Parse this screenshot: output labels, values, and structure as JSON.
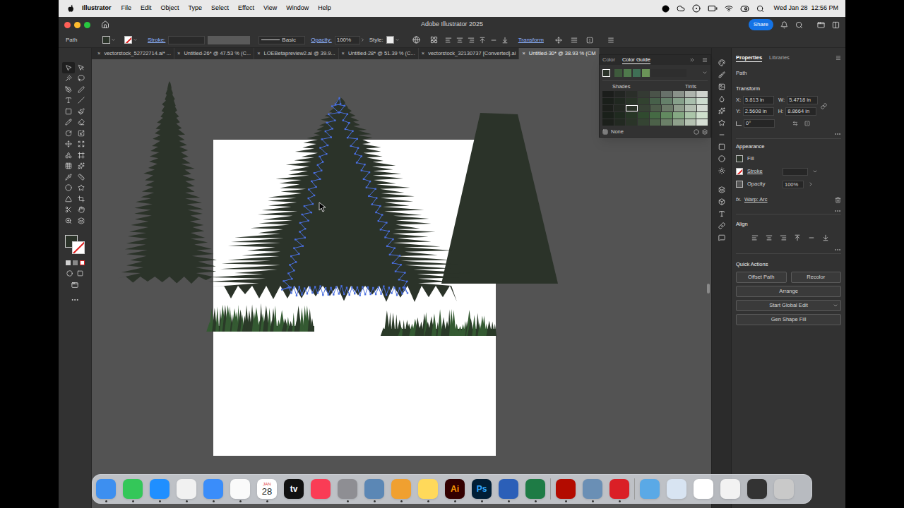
{
  "menu_bar": {
    "app": "Illustrator",
    "items": [
      "File",
      "Edit",
      "Object",
      "Type",
      "Select",
      "Effect",
      "View",
      "Window",
      "Help"
    ],
    "clock": "Wed Jan 28  12:56 PM"
  },
  "window": {
    "title": "Adobe Illustrator 2025",
    "share": "Share"
  },
  "control_bar": {
    "selection": "Path",
    "fill_color": "#2b3329",
    "stroke_label": "Stroke:",
    "profile": "Basic",
    "opacity_label": "Opacity:",
    "opacity": "100%",
    "style_label": "Style:",
    "transform": "Transform"
  },
  "tab_close": "×",
  "tabs": [
    {
      "label": "vectorstock_52722714.ai* ...",
      "selected": false
    },
    {
      "label": "Untitled-26* @ 47.53 % (C...",
      "selected": false
    },
    {
      "label": "LOEBetapreview2.ai @ 39.9...",
      "selected": false
    },
    {
      "label": "Untitled-28* @ 51.39 % (C...",
      "selected": false
    },
    {
      "label": "vectorstock_32130737 [Converted].ai",
      "selected": false
    },
    {
      "label": "Untitled-30* @ 38.93 % (CM",
      "selected": true
    }
  ],
  "color_guide": {
    "tabs": [
      {
        "label": "Color",
        "selected": false
      },
      {
        "label": "Color Guide",
        "selected": true
      }
    ],
    "harmony": [
      {
        "color": "#2b3329",
        "selected": true
      },
      {
        "color": "#3e5a3c",
        "selected": false
      },
      {
        "color": "#4f7a4c",
        "selected": false
      },
      {
        "color": "#3f6f55",
        "selected": false
      },
      {
        "color": "#6b9458",
        "selected": false
      }
    ],
    "shades": "Shades",
    "tints": "Tints",
    "none": "None",
    "grid": [
      [
        {
          "color": "#1b1d1b",
          "selected": false
        },
        {
          "color": "#222522",
          "selected": false
        },
        {
          "color": "#2a2e29",
          "selected": false
        },
        {
          "color": "#343a33",
          "selected": false
        },
        {
          "color": "#4a5349",
          "selected": false
        },
        {
          "color": "#68716a",
          "selected": false
        },
        {
          "color": "#8a928a",
          "selected": false
        },
        {
          "color": "#aeb4ad",
          "selected": false
        },
        {
          "color": "#cfd3ce",
          "selected": false
        }
      ],
      [
        {
          "color": "#1a1f1a",
          "selected": false
        },
        {
          "color": "#202820",
          "selected": false
        },
        {
          "color": "#283327",
          "selected": false
        },
        {
          "color": "#324230",
          "selected": false
        },
        {
          "color": "#47604a",
          "selected": false
        },
        {
          "color": "#65806a",
          "selected": false
        },
        {
          "color": "#86a08a",
          "selected": false
        },
        {
          "color": "#a9bfad",
          "selected": false
        },
        {
          "color": "#cddccf",
          "selected": false
        }
      ],
      [
        {
          "color": "#1c1f1b",
          "selected": false
        },
        {
          "color": "#232822",
          "selected": false
        },
        {
          "color": "#2b3329",
          "selected": true
        },
        {
          "color": "#374235",
          "selected": false
        },
        {
          "color": "#4d5c4a",
          "selected": false
        },
        {
          "color": "#6c7b69",
          "selected": false
        },
        {
          "color": "#8f9d8c",
          "selected": false
        },
        {
          "color": "#b3beb1",
          "selected": false
        },
        {
          "color": "#d4dbd3",
          "selected": false
        }
      ],
      [
        {
          "color": "#1a201a",
          "selected": false
        },
        {
          "color": "#1f2a1f",
          "selected": false
        },
        {
          "color": "#273726",
          "selected": false
        },
        {
          "color": "#304a2f",
          "selected": false
        },
        {
          "color": "#456a44",
          "selected": false
        },
        {
          "color": "#628a60",
          "selected": false
        },
        {
          "color": "#85a883",
          "selected": false
        },
        {
          "color": "#abc5a9",
          "selected": false
        },
        {
          "color": "#cfe0cd",
          "selected": false
        }
      ],
      [
        {
          "color": "#1c201b",
          "selected": false
        },
        {
          "color": "#222921",
          "selected": false
        },
        {
          "color": "#2a3428",
          "selected": false
        },
        {
          "color": "#354433",
          "selected": false
        },
        {
          "color": "#4c6149",
          "selected": false
        },
        {
          "color": "#6b8068",
          "selected": false
        },
        {
          "color": "#8fa18c",
          "selected": false
        },
        {
          "color": "#b5c2b2",
          "selected": false
        },
        {
          "color": "#d6ded4",
          "selected": false
        }
      ]
    ]
  },
  "properties": {
    "tabs": [
      {
        "label": "Properties",
        "selected": true
      },
      {
        "label": "Libraries",
        "selected": false
      }
    ],
    "object": "Path",
    "transform": {
      "title": "Transform",
      "fields": [
        {
          "label": "X:",
          "value": "5.813 in"
        },
        {
          "label": "W:",
          "value": "5.4718 in"
        },
        {
          "label": "Y:",
          "value": "2.5608 in"
        },
        {
          "label": "H:",
          "value": "8.8664 in"
        }
      ],
      "angle": "0°"
    },
    "appearance": {
      "title": "Appearance",
      "fill": "Fill",
      "stroke": "Stroke",
      "opacity_label": "Opacity",
      "opacity": "100%",
      "effect_prefix": "fx.",
      "effect": "Warp: Arc"
    },
    "align": {
      "title": "Align"
    },
    "quick_actions": {
      "title": "Quick Actions",
      "buttons": [
        "Offset Path",
        "Recolor",
        "Arrange",
        "Start Global Edit",
        "Gen Shape Fill"
      ]
    }
  },
  "dock": [
    {
      "kind": "app",
      "color": "#3d8ff0",
      "label": "",
      "text_color": "#ffffff",
      "running": true
    },
    {
      "kind": "app",
      "color": "#34c759",
      "label": "",
      "text_color": "#ffffff",
      "running": true
    },
    {
      "kind": "app",
      "color": "#1f8fff",
      "label": "",
      "text_color": "#ffffff",
      "running": true
    },
    {
      "kind": "app",
      "color": "#f1f1f1",
      "label": "",
      "text_color": "#000000",
      "running": true
    },
    {
      "kind": "app",
      "color": "#3a8dfa",
      "label": "",
      "text_color": "#ffffff",
      "running": true
    },
    {
      "kind": "app",
      "color": "#fafafa",
      "label": "",
      "text_color": "#000000",
      "running": true
    },
    {
      "kind": "calendar",
      "color": "#ffffff",
      "label": "28",
      "month": "JAN",
      "text_color": "#222222",
      "running": true
    },
    {
      "kind": "app",
      "color": "#111111",
      "label": "tv",
      "text_color": "#ffffff",
      "running": false
    },
    {
      "kind": "app",
      "color": "#fa3c55",
      "label": "",
      "text_color": "#ffffff",
      "running": false
    },
    {
      "kind": "app",
      "color": "#8e8e93",
      "label": "",
      "text_color": "#ffffff",
      "running": true
    },
    {
      "kind": "app",
      "color": "#5b87b5",
      "label": "",
      "text_color": "#ffffff",
      "running": true
    },
    {
      "kind": "app",
      "color": "#f0a030",
      "label": "",
      "text_color": "#ffffff",
      "running": true
    },
    {
      "kind": "app",
      "color": "#ffd95a",
      "label": "",
      "text_color": "#000000",
      "running": true
    },
    {
      "kind": "app",
      "color": "#330000",
      "label": "Ai",
      "text_color": "#ff9a00",
      "running": true
    },
    {
      "kind": "app",
      "color": "#001e36",
      "label": "Ps",
      "text_color": "#31a8ff",
      "running": true
    },
    {
      "kind": "app",
      "color": "#2b5fb8",
      "label": "",
      "text_color": "#ffffff",
      "running": true
    },
    {
      "kind": "app",
      "color": "#1e7b45",
      "label": "",
      "text_color": "#ffffff",
      "running": true
    },
    {
      "kind": "separator"
    },
    {
      "kind": "app",
      "color": "#b30b00",
      "label": "",
      "text_color": "#ffffff",
      "running": true
    },
    {
      "kind": "app",
      "color": "#6a8fb5",
      "label": "",
      "text_color": "#ffffff",
      "running": true
    },
    {
      "kind": "app",
      "color": "#da1f26",
      "label": "",
      "text_color": "#ffffff",
      "running": true
    },
    {
      "kind": "separator"
    },
    {
      "kind": "app",
      "color": "#5aa9e6",
      "label": "",
      "text_color": "#ffffff",
      "running": false
    },
    {
      "kind": "app",
      "color": "#d8e4f2",
      "label": "",
      "text_color": "#000000",
      "running": false
    },
    {
      "kind": "app",
      "color": "#ffffff",
      "label": "",
      "text_color": "#000000",
      "running": false
    },
    {
      "kind": "app",
      "color": "#f2f2f2",
      "label": "",
      "text_color": "#000000",
      "running": false
    },
    {
      "kind": "app",
      "color": "#333333",
      "label": "",
      "text_color": "#ffffff",
      "running": false
    },
    {
      "kind": "app",
      "color": "#c9c9c9",
      "label": "",
      "text_color": "#000000",
      "running": false
    }
  ]
}
